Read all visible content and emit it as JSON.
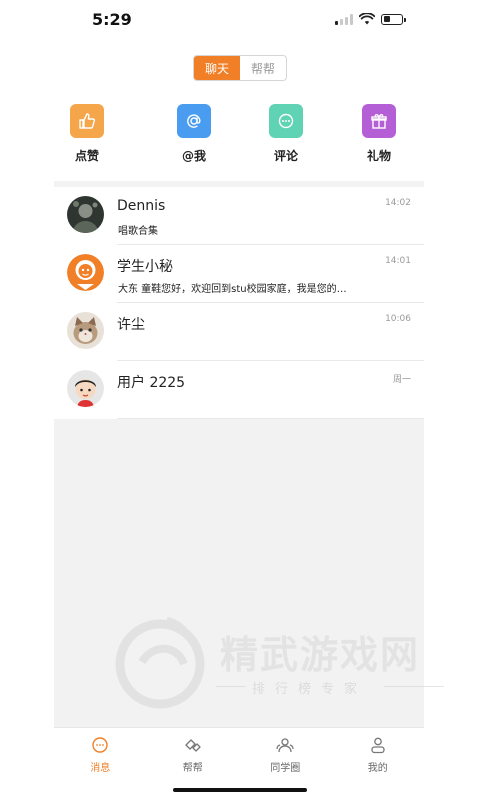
{
  "status_bar": {
    "time": "5:29",
    "battery_level": 0.4
  },
  "segment_tabs": [
    {
      "label": "聊天",
      "active": true
    },
    {
      "label": "帮帮",
      "active": false
    }
  ],
  "actions": [
    {
      "label": "点赞",
      "icon": "thumbs-up-icon",
      "color": "#f5a54a"
    },
    {
      "label": "@我",
      "icon": "at-icon",
      "color": "#4a9cf0"
    },
    {
      "label": "评论",
      "icon": "comment-icon",
      "color": "#5fd3b3"
    },
    {
      "label": "礼物",
      "icon": "gift-icon",
      "color": "#b55fd6"
    }
  ],
  "chats": [
    {
      "name": "Dennis",
      "preview": "唱歌合集",
      "time": "14:02",
      "avatar": "avatar-dennis"
    },
    {
      "name": "学生小秘",
      "preview": "大东 童鞋您好，欢迎回到stu校园家庭，我是您的…",
      "time": "14:01",
      "avatar": "avatar-assistant"
    },
    {
      "name": "许尘",
      "preview": "",
      "time": "10:06",
      "avatar": "avatar-cat"
    },
    {
      "name": "用户 2225",
      "preview": "",
      "time": "周一",
      "avatar": "avatar-cartoon"
    }
  ],
  "watermark": {
    "logo": "精武游戏网",
    "subtitle": "排行榜专家"
  },
  "tabbar": [
    {
      "label": "消息",
      "icon": "message-icon",
      "active": true
    },
    {
      "label": "帮帮",
      "icon": "handshake-icon",
      "active": false
    },
    {
      "label": "同学圈",
      "icon": "people-icon",
      "active": false
    },
    {
      "label": "我的",
      "icon": "person-icon",
      "active": false
    }
  ],
  "colors": {
    "accent": "#f07f27",
    "background": "#f2f2f2"
  }
}
